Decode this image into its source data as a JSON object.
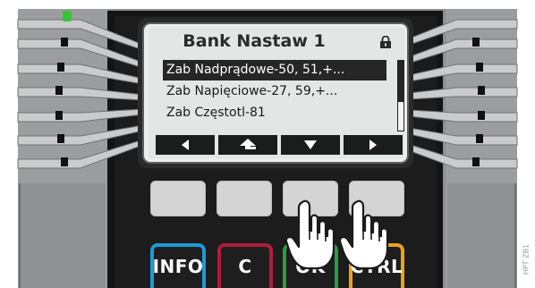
{
  "display": {
    "title": "Bank Nastaw 1",
    "lock_icon": "padlock-icon",
    "menu_items": [
      {
        "label": "Zab Nadprądowe-50, 51,+...",
        "selected": true
      },
      {
        "label": "Zab Napięciowe-27, 59,+...",
        "selected": false
      },
      {
        "label": "Zab Częstotl-81",
        "selected": false
      }
    ],
    "softkeys": [
      {
        "icon": "arrow-left-icon"
      },
      {
        "icon": "arrow-up-return-icon"
      },
      {
        "icon": "arrow-down-icon"
      },
      {
        "icon": "arrow-right-icon"
      }
    ]
  },
  "keys": {
    "info": "INFO",
    "c": "C",
    "ok": "OK",
    "ctrl": "CTRL"
  },
  "key_colors": {
    "info": "#1e9ad6",
    "c": "#b01e3c",
    "ok": "#2e9a44",
    "ctrl": "#e8a31d"
  },
  "led_color": "#39c33a",
  "watermark": "HPT ZB1"
}
